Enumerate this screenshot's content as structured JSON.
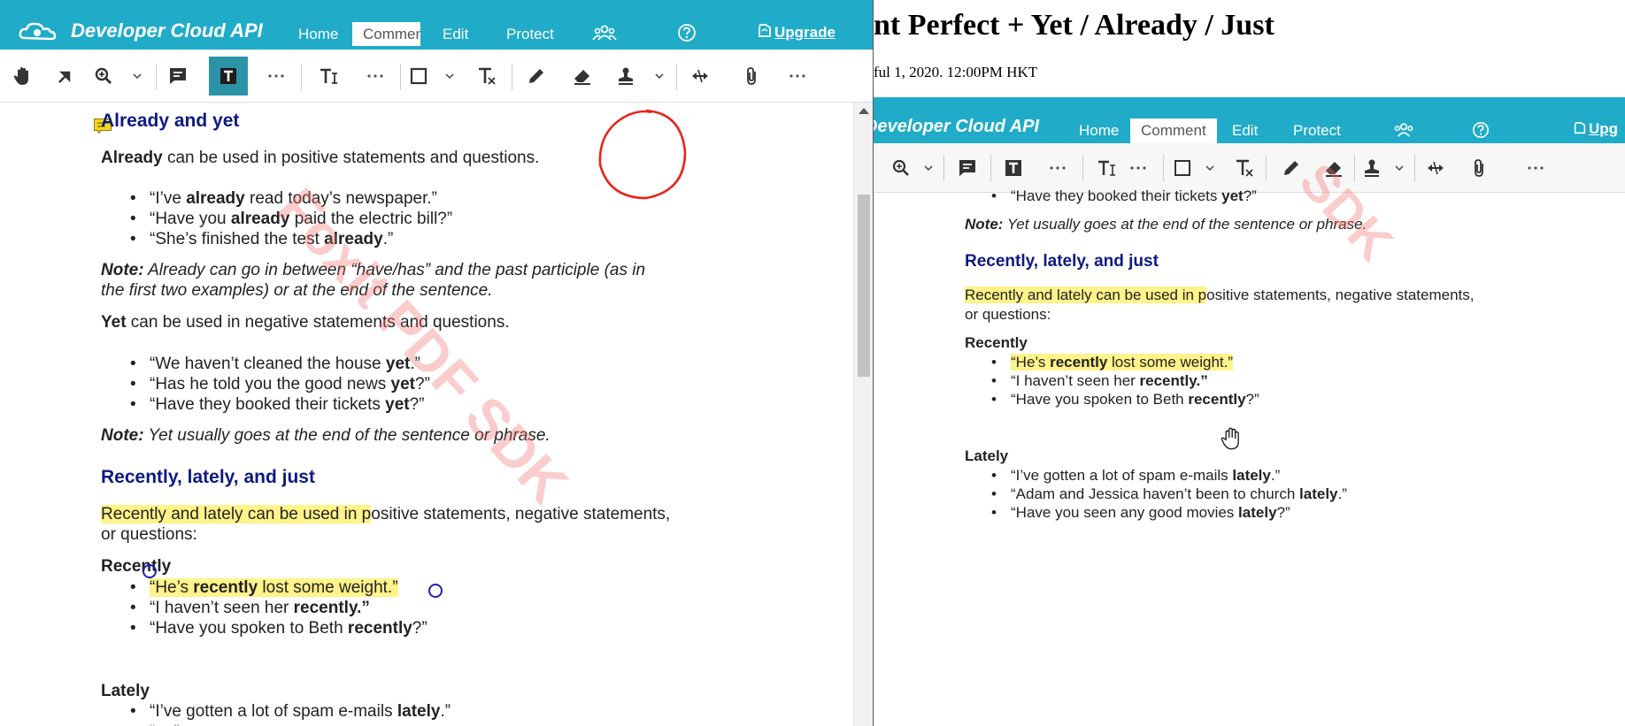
{
  "left": {
    "header": {
      "logo_text": "Developer Cloud API",
      "tabs": [
        "Home",
        "Comment",
        "Edit",
        "Protect"
      ],
      "upgrade_label": "Upgrade"
    },
    "doc": {
      "h_already_yet": "Already and yet",
      "p1_b": "Already",
      "p1_rest": " can be used in positive statements and questions.",
      "al1_a": "“I’ve ",
      "al1_b": "already",
      "al1_c": " read today’s newspaper.”",
      "al2_a": "“Have you ",
      "al2_b": "already",
      "al2_c": " paid the electric bill?”",
      "al3_a": "“She’s finished the test ",
      "al3_b": "already",
      "al3_c": ".”",
      "note1_b": "Note:",
      "note1_l1": " Already can go in between “have/has” and the past participle (as in",
      "note1_l2": "the first two examples) or at the end of the sentence.",
      "p2_b": "Yet",
      "p2_rest": " can be used in negative statements and questions.",
      "yl1_a": "“We haven’t cleaned the house ",
      "yl1_b": "yet",
      "yl1_c": ".”",
      "yl2_a": "“Has he told you the good news ",
      "yl2_b": "yet",
      "yl2_c": "?”",
      "yl3_a": "“Have they booked their tickets ",
      "yl3_b": "yet",
      "yl3_c": "?”",
      "note2_b": "Note:",
      "note2_rest": " Yet usually goes at the end of the sentence or phrase.",
      "h_recently": "Recently, lately, and just",
      "p3_hl": "Recently and lately can be used in p",
      "p3_rest": "ositive statements, negative statements,",
      "p3_l2": "or questions:",
      "recently_label": "Recently",
      "rl1_hl_a": "“He’s ",
      "rl1_hl_b": "recently",
      "rl1_hl_c": " lost some weight.”",
      "rl2_a": "“I haven’t seen her ",
      "rl2_b": "recently.”",
      "rl3_a": "“Have you spoken to Beth ",
      "rl3_b": "recently",
      "rl3_c": "?”",
      "lately_label": "Lately",
      "ll1_a": "“I’ve gotten a lot of spam e-mails ",
      "ll1_b": "lately",
      "ll1_c": ".”"
    },
    "watermark": "Foxit PDF SDK"
  },
  "right": {
    "page_title": "nt Perfect + Yet / Already / Just",
    "page_date": "ful 1, 2020. 12:00PM HKT",
    "header": {
      "logo_text": "Developer Cloud API",
      "tabs": [
        "Home",
        "Comment",
        "Edit",
        "Protect"
      ],
      "upgrade_label": "Upg"
    },
    "doc": {
      "yl3_a": "“Have they booked their tickets ",
      "yl3_b": "yet",
      "yl3_c": "?”",
      "note2_b": "Note:",
      "note2_rest": " Yet usually goes at the end of the sentence or phrase.",
      "h_recently": "Recently, lately, and just",
      "p3_hl": "Recently and lately can be used in p",
      "p3_rest": "ositive statements, negative statements,",
      "p3_l2": "or questions:",
      "recently_label": "Recently",
      "rl1_hl_a": "“He’s ",
      "rl1_hl_b": "recently",
      "rl1_hl_c": " lost some weight.”",
      "rl2_a": "“I haven’t seen her ",
      "rl2_b": "recently.”",
      "rl3_a": "“Have you spoken to Beth ",
      "rl3_b": "recently",
      "rl3_c": "?”",
      "lately_label": "Lately",
      "ll1_a": "“I’ve gotten a lot of spam e-mails ",
      "ll1_b": "lately",
      "ll1_c": ".”",
      "ll2_a": "“Adam and Jessica haven’t been to church ",
      "ll2_b": "lately",
      "ll2_c": ".”",
      "ll3_a": "“Have you seen any good movies ",
      "ll3_b": "lately",
      "ll3_c": "?”"
    },
    "watermark": "SDK"
  },
  "colors": {
    "brand": "#20abc9",
    "heading": "#0d1a80",
    "highlight": "#fff38a",
    "ink_circle": "#e8241c",
    "watermark": "#f06e6e"
  }
}
